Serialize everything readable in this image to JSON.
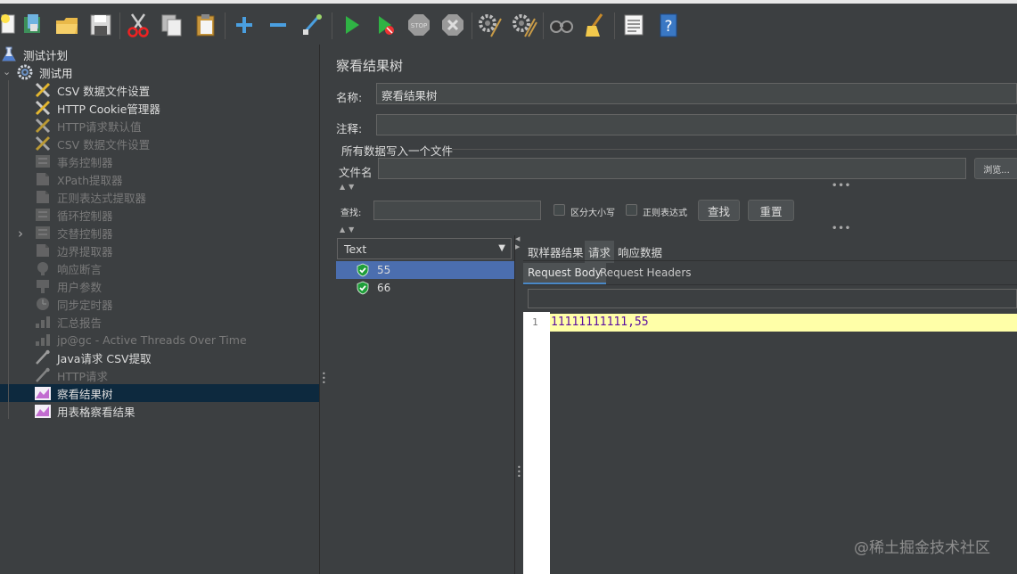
{
  "toolbar": {
    "icons": [
      "new-plan-icon",
      "templates-icon",
      "open-icon",
      "save-icon",
      "cut-icon",
      "copy-icon",
      "paste-icon",
      "expand-icon",
      "collapse-icon",
      "toggle-icon",
      "start-icon",
      "start-no-pause-icon",
      "stop-icon",
      "shutdown-icon",
      "clear-icon",
      "clear-all-icon",
      "search-icon",
      "reset-search-icon",
      "function-helper-icon",
      "help-icon"
    ]
  },
  "tree": {
    "items": [
      {
        "label": "测试计划",
        "icon": "flask-icon",
        "enabled": true
      },
      {
        "label": "测试用",
        "icon": "gear-icon",
        "enabled": true
      },
      {
        "label": "CSV 数据文件设置",
        "icon": "wrench-icon",
        "enabled": true
      },
      {
        "label": "HTTP Cookie管理器",
        "icon": "wrench-icon",
        "enabled": true
      },
      {
        "label": "HTTP请求默认值",
        "icon": "wrench-icon",
        "enabled": false
      },
      {
        "label": "CSV 数据文件设置",
        "icon": "wrench-icon",
        "enabled": false
      },
      {
        "label": "事务控制器",
        "icon": "controller-icon",
        "enabled": false
      },
      {
        "label": "XPath提取器",
        "icon": "extractor-icon",
        "enabled": false
      },
      {
        "label": "正则表达式提取器",
        "icon": "extractor-icon",
        "enabled": false
      },
      {
        "label": "循环控制器",
        "icon": "controller-icon",
        "enabled": false
      },
      {
        "label": "交替控制器",
        "icon": "controller-icon",
        "enabled": false
      },
      {
        "label": "边界提取器",
        "icon": "extractor-icon",
        "enabled": false
      },
      {
        "label": "响应断言",
        "icon": "assertion-icon",
        "enabled": false
      },
      {
        "label": "用户参数",
        "icon": "preprocessor-icon",
        "enabled": false
      },
      {
        "label": "同步定时器",
        "icon": "timer-icon",
        "enabled": false
      },
      {
        "label": "汇总报告",
        "icon": "chart-icon",
        "enabled": false
      },
      {
        "label": "jp@gc - Active Threads Over Time",
        "icon": "chart-icon",
        "enabled": false
      },
      {
        "label": "Java请求 CSV提取",
        "icon": "pipette-icon",
        "enabled": true
      },
      {
        "label": "HTTP请求",
        "icon": "pipette-icon",
        "enabled": false
      },
      {
        "label": "察看结果树",
        "icon": "listener-icon",
        "enabled": true
      },
      {
        "label": "用表格察看结果",
        "icon": "listener-icon",
        "enabled": true
      }
    ]
  },
  "panel": {
    "title": "察看结果树",
    "name_label": "名称:",
    "name_value": "察看结果树",
    "comment_label": "注释:",
    "comment_value": "",
    "file_section": "所有数据写入一个文件",
    "filename_label": "文件名",
    "filename_value": "",
    "browse_label": "浏览...",
    "search_label": "查找:",
    "search_value": "",
    "case_sensitive_label": "区分大小写",
    "regex_label": "正则表达式",
    "find_button": "查找",
    "reset_button": "重置"
  },
  "results": {
    "renderer": "Text",
    "samples": [
      {
        "label": "55",
        "status": "success"
      },
      {
        "label": "66",
        "status": "success"
      }
    ],
    "tabs": [
      "取样器结果",
      "请求",
      "响应数据"
    ],
    "active_tab": "请求",
    "subtabs": [
      "Request Body",
      "Request Headers"
    ],
    "active_subtab": "Request Body",
    "line_number": "1",
    "body_text": "11111111111,55"
  },
  "watermark": "@稀土掘金技术社区",
  "colors": {
    "background": "#3c3f41",
    "selection": "#0d293e",
    "list_selection": "#4b6eaf",
    "highlight_line": "#ffffa8"
  }
}
